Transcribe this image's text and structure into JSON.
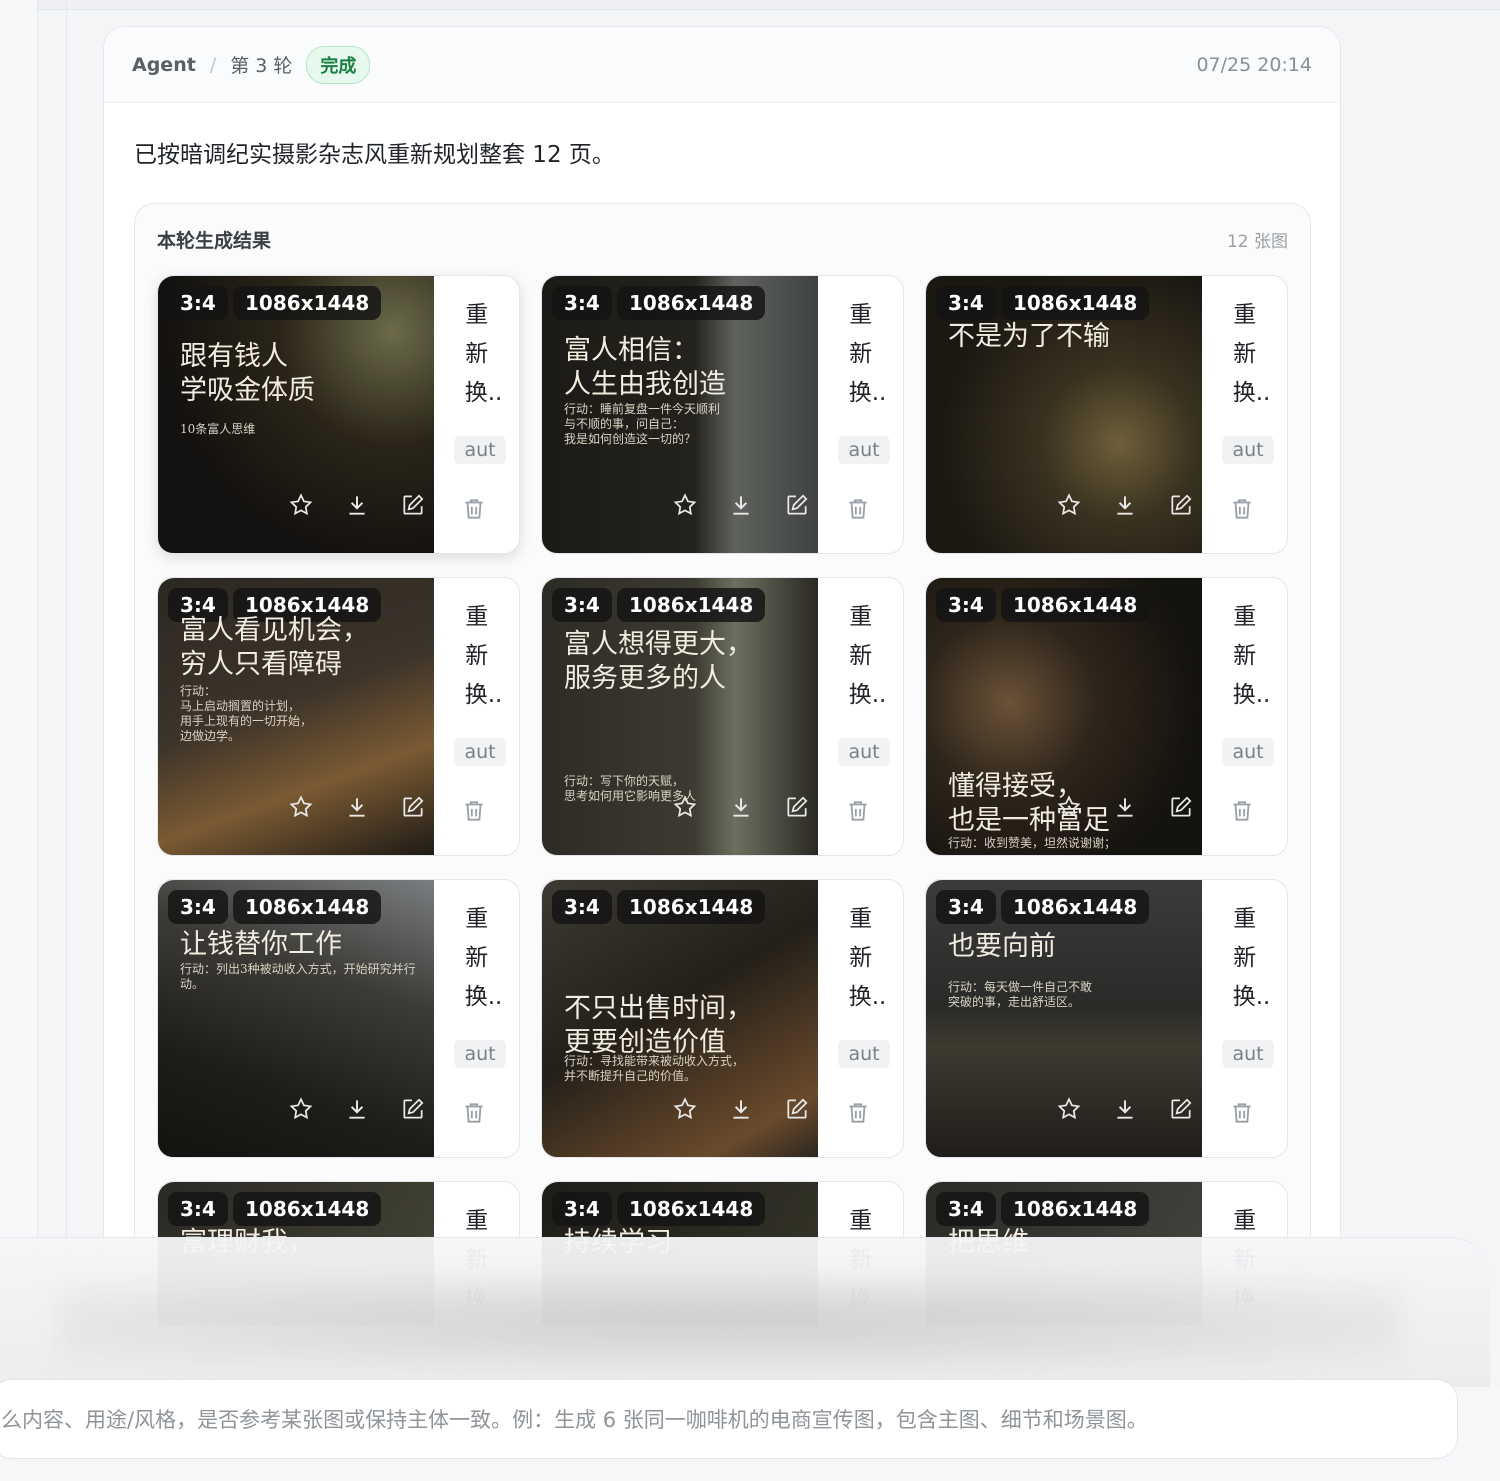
{
  "header": {
    "agent": "Agent",
    "separator": "/",
    "round": "第 3 轮",
    "status": "完成",
    "timestamp": "07/25 20:14"
  },
  "message": "已按暗调纪实摄影杂志风重新规划整套 12 页。",
  "results": {
    "title": "本轮生成结果",
    "count": "12 张图"
  },
  "tile_common": {
    "ratio": "3:4",
    "size": "1086x1448",
    "action_label": "重新换..",
    "mode": "aut"
  },
  "tiles": [
    {
      "title": "跟有钱人\n学吸金体质",
      "subtitle": "10条富人思维"
    },
    {
      "title": "富人相信：\n人生由我创造",
      "subtitle": "行动：睡前复盘一件今天顺利\n与不顺的事，问自己：\n我是如何创造这一切的？"
    },
    {
      "title": "不是为了不输",
      "subtitle": ""
    },
    {
      "title": "富人看见机会，\n穷人只看障碍",
      "subtitle": "行动：\n马上启动搁置的计划，\n用手上现有的一切开始，\n边做边学。"
    },
    {
      "title": "富人想得更大，\n服务更多的人",
      "subtitle": "行动：写下你的天赋，\n思考如何用它影响更多人"
    },
    {
      "title": "懂得接受，\n也是一种富足",
      "subtitle": "行动：收到赞美，坦然说谢谢；"
    },
    {
      "title": "让钱替你工作",
      "subtitle": "行动：列出3种被动收入方式，开始研究并行动。"
    },
    {
      "title": "不只出售时间，\n更要创造价值",
      "subtitle": "行动：寻找能带来被动收入方式，\n并不断提升自己的价值。"
    },
    {
      "title": "也要向前",
      "subtitle": "行动：每天做一件自己不敢\n突破的事，走出舒适区。"
    },
    {
      "title": "富理财我，",
      "subtitle": ""
    },
    {
      "title": "持续学习",
      "subtitle": ""
    },
    {
      "title": "把思维",
      "subtitle": ""
    }
  ],
  "composer": {
    "placeholder": "么内容、用途/风格，是否参考某张图或保持主体一致。例：生成 6 张同一咖啡机的电商宣传图，包含主图、细节和场景图。"
  },
  "colors": {
    "status_badge_bg": "#e7f8ee",
    "status_badge_text": "#1a7f43"
  }
}
